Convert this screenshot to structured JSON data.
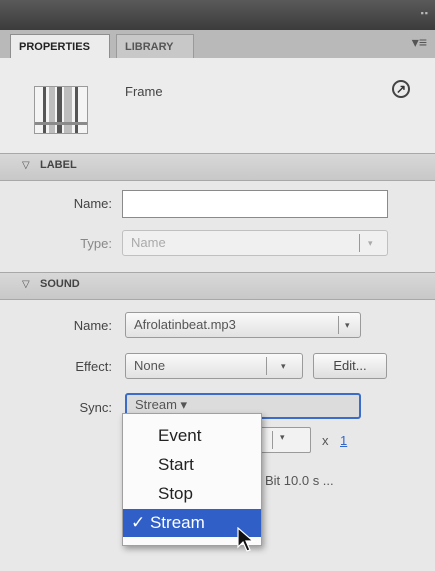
{
  "tabs": [
    {
      "label": "PROPERTIES",
      "active": true
    },
    {
      "label": "LIBRARY",
      "active": false
    }
  ],
  "header": {
    "frame_label": "Frame",
    "help_icon": "circled-arrow-icon",
    "panel_menu_icon": "panel-menu-icon"
  },
  "label_section": {
    "title": "LABEL",
    "name_label": "Name:",
    "name_value": "",
    "type_label": "Type:",
    "type_value": "Name"
  },
  "sound_section": {
    "title": "SOUND",
    "name_label": "Name:",
    "name_value": "Afrolatinbeat.mp3",
    "effect_label": "Effect:",
    "effect_value": "None",
    "edit_button": "Edit...",
    "sync_label": "Sync:",
    "sync_value": "Stream",
    "repeat_multiplier": "x",
    "repeat_count": "1",
    "info_text": "Bit 10.0 s ..."
  },
  "sync_menu": {
    "items": [
      {
        "label": "Event",
        "selected": false
      },
      {
        "label": "Start",
        "selected": false
      },
      {
        "label": "Stop",
        "selected": false
      },
      {
        "label": "✓ Stream",
        "selected": true
      }
    ]
  },
  "colors": {
    "selection_blue": "#2f5fc7",
    "focus_ring": "#3b6cc8",
    "panel_bg": "#e8e8e8"
  }
}
